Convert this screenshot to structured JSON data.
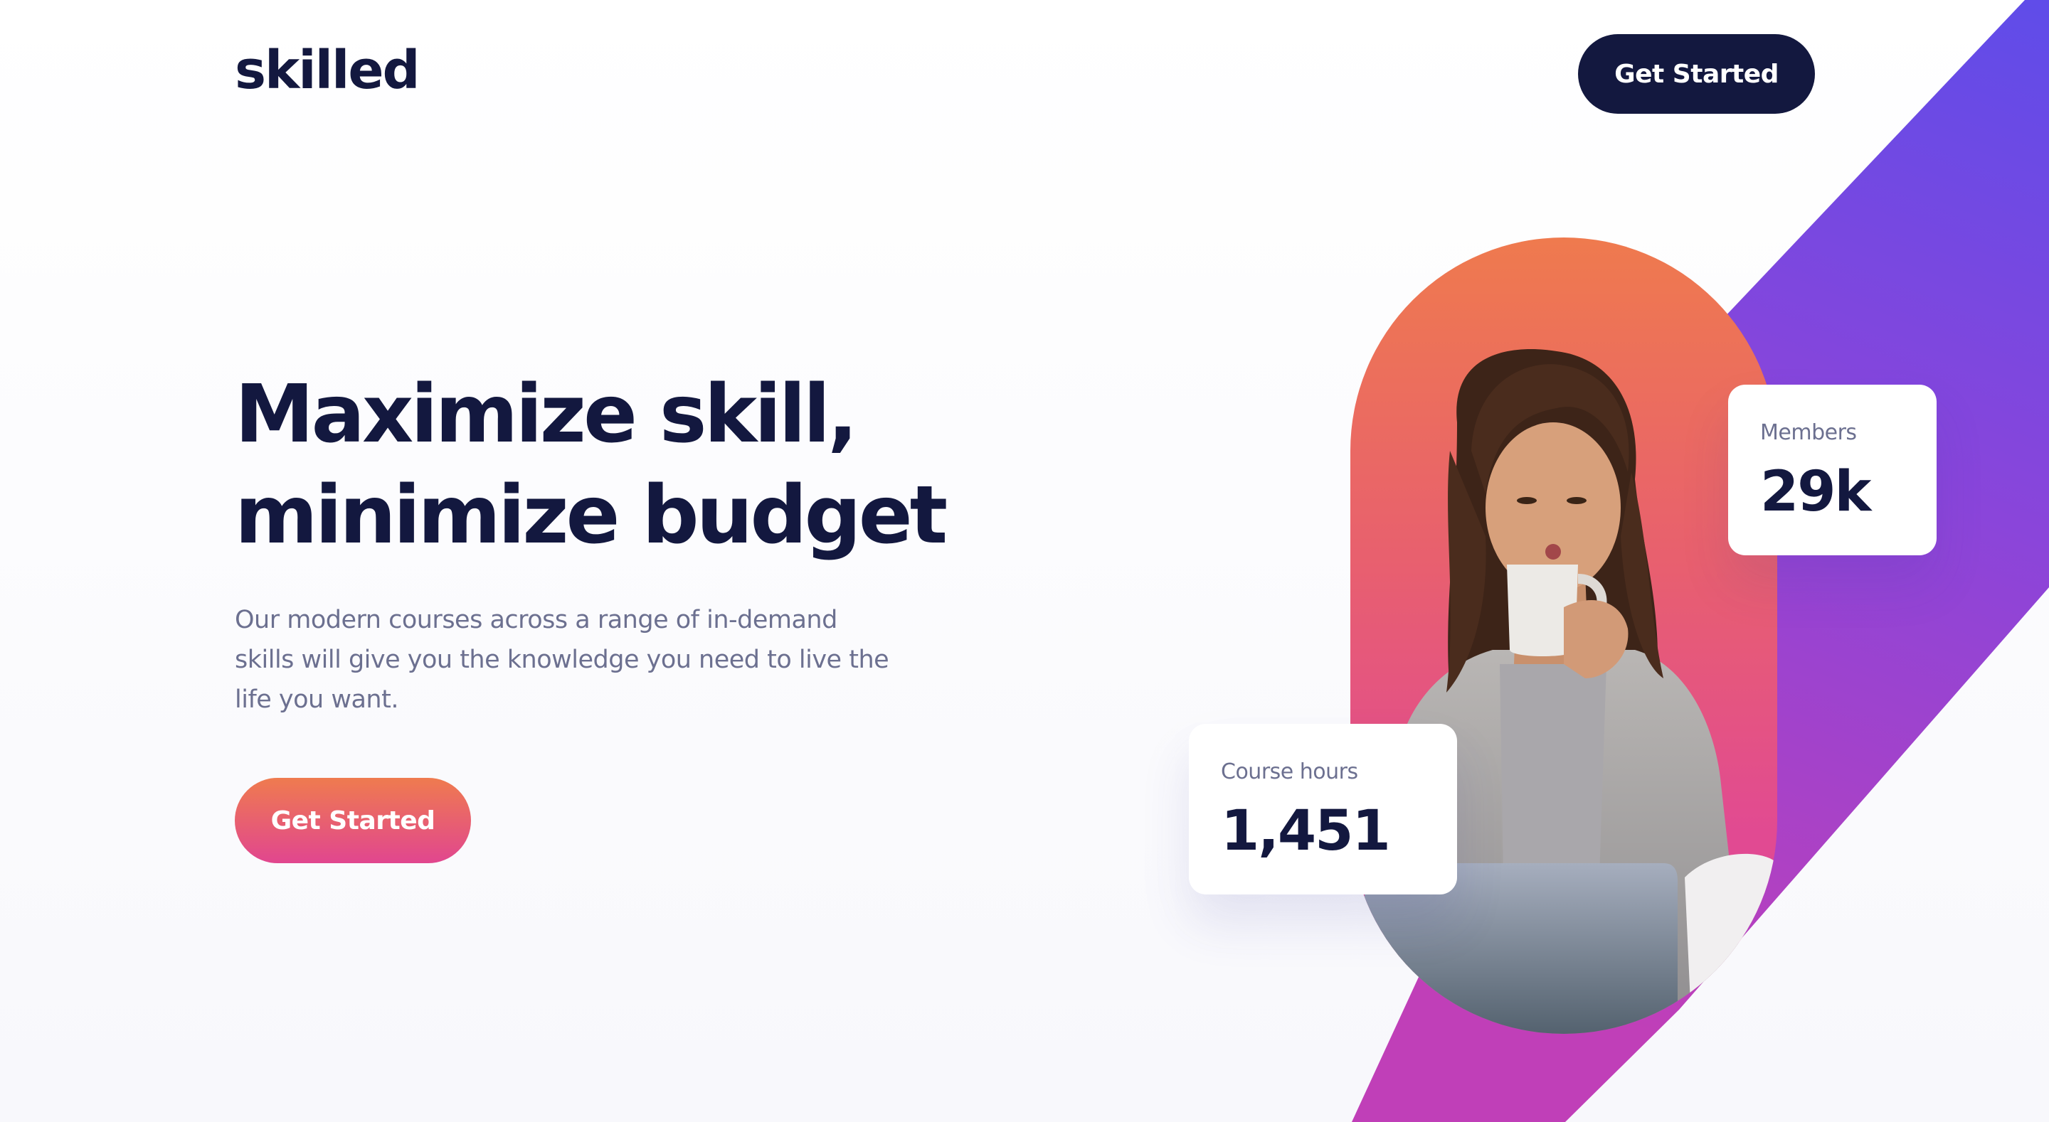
{
  "header": {
    "logo": "skilled",
    "cta_label": "Get Started"
  },
  "hero": {
    "headline_line1": "Maximize skill,",
    "headline_line2": "minimize budget",
    "description": "Our modern courses across a range of in-demand skills will give you the knowledge you need to live the life you want.",
    "cta_label": "Get Started"
  },
  "stats": {
    "members": {
      "label": "Members",
      "value": "29k"
    },
    "course_hours": {
      "label": "Course hours",
      "value": "1,451"
    }
  },
  "colors": {
    "navy": "#13183f",
    "text_muted": "#6c7090",
    "gradient_orange": "#ef7b4f",
    "gradient_pink": "#e1468f",
    "band_purple_top": "#6a4ee8",
    "band_purple_bottom": "#b73fbe"
  }
}
